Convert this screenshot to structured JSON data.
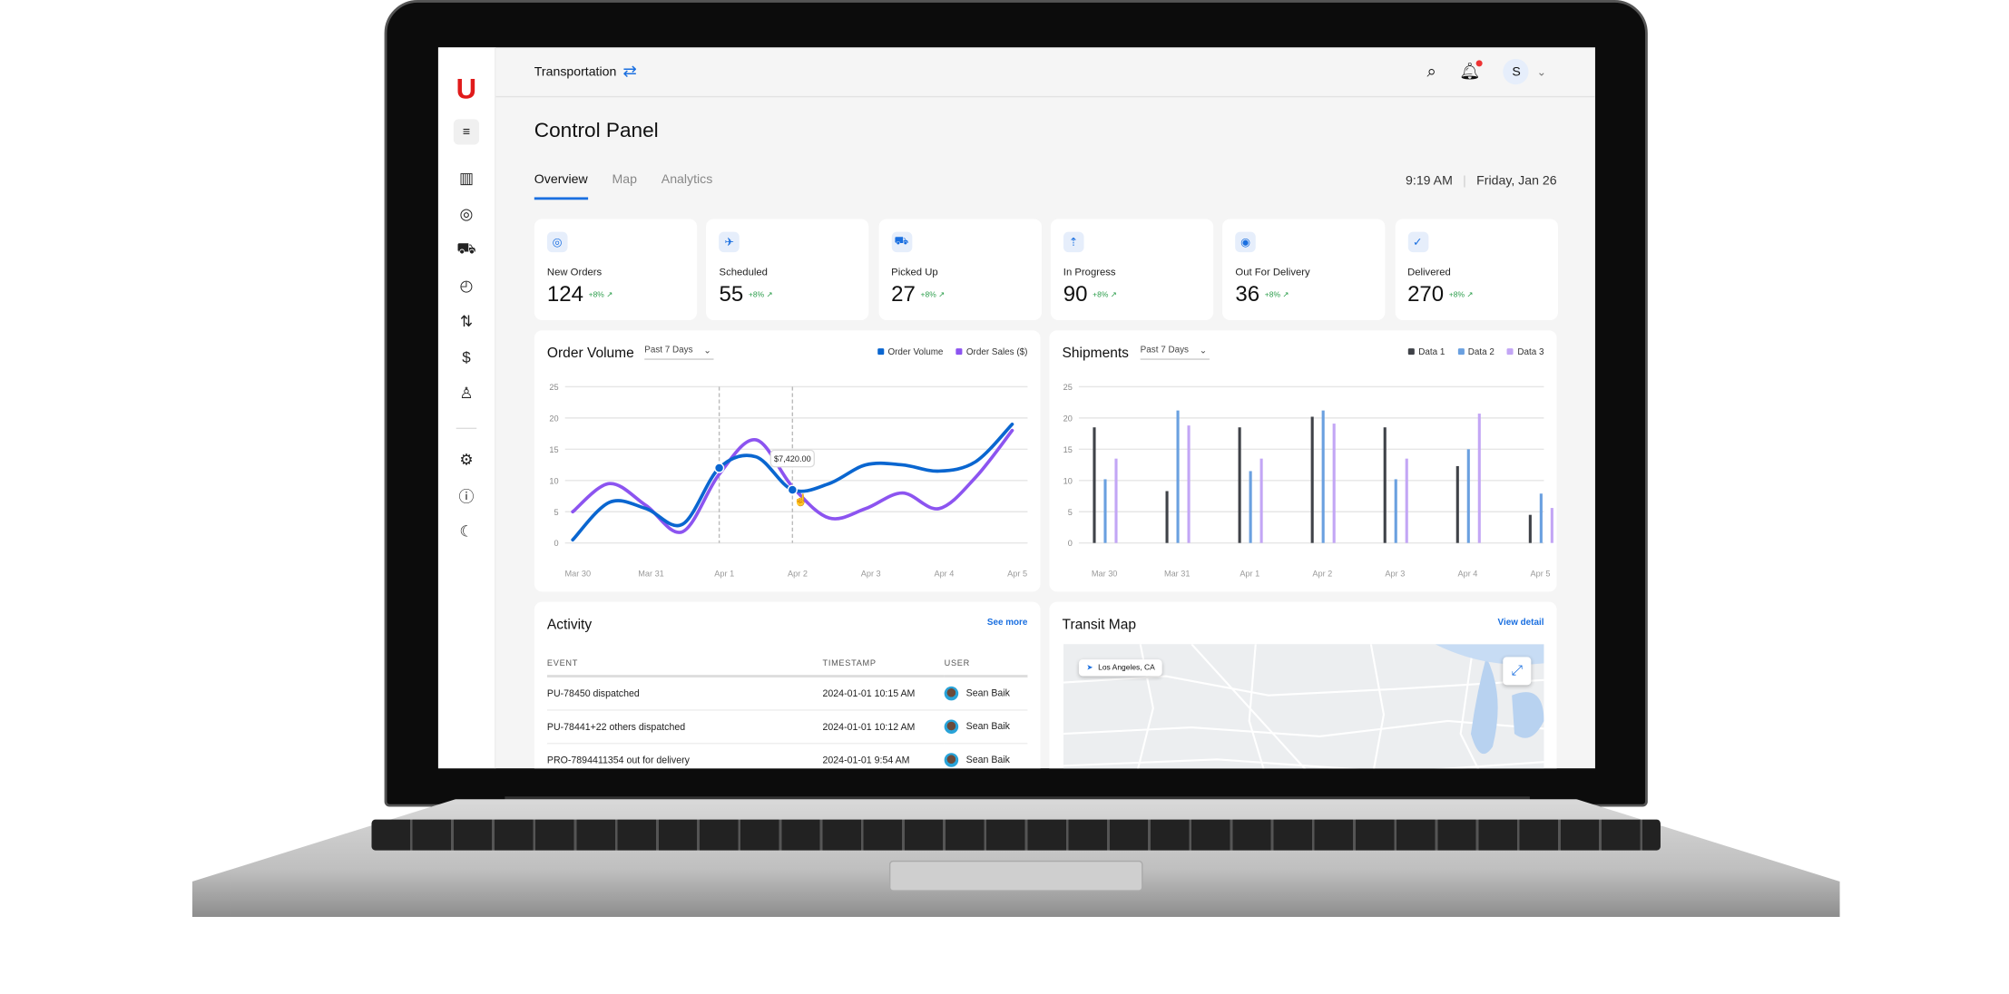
{
  "app": {
    "logo": "U",
    "workspace": "Transportation",
    "avatar_initial": "S"
  },
  "sidebar": {
    "icons": [
      "menu-collapse-icon",
      "map-icon",
      "target-icon",
      "truck-icon",
      "gauge-icon",
      "route-icon",
      "dollar-icon",
      "user-icon",
      "gear-icon",
      "help-icon",
      "moon-icon"
    ]
  },
  "page": {
    "title": "Control Panel",
    "tabs": [
      "Overview",
      "Map",
      "Analytics"
    ],
    "active_tab": "Overview",
    "time": "9:19 AM",
    "date": "Friday, Jan 26"
  },
  "stats": [
    {
      "label": "New Orders",
      "value": "124",
      "change": "+8%"
    },
    {
      "label": "Scheduled",
      "value": "55",
      "change": "+8%"
    },
    {
      "label": "Picked Up",
      "value": "27",
      "change": "+8%"
    },
    {
      "label": "In Progress",
      "value": "90",
      "change": "+8%"
    },
    {
      "label": "Out For Delivery",
      "value": "36",
      "change": "+8%"
    },
    {
      "label": "Delivered",
      "value": "270",
      "change": "+8%"
    }
  ],
  "colors": {
    "accent": "#1a6fe0",
    "logo": "#e01b1b",
    "positive": "#2a9d4a"
  },
  "chart_data": [
    {
      "type": "line",
      "title": "Order Volume",
      "range_select": "Past 7 Days",
      "x": [
        "Mar 30",
        "Mar 30 12:00",
        "Mar 31",
        "Mar 31 12:00",
        "Apr 1",
        "Apr 1 12:00",
        "Apr 2",
        "Apr 2 12:00",
        "Apr 3",
        "Apr 3 12:00",
        "Apr 4",
        "Apr 4 12:00",
        "Apr 5"
      ],
      "xticks": [
        "Mar 30",
        "Mar 31",
        "Apr 1",
        "Apr 2",
        "Apr 3",
        "Apr 4",
        "Apr 5"
      ],
      "yticks": [
        0,
        5,
        10,
        15,
        20,
        25
      ],
      "ylim": [
        0,
        25
      ],
      "grid": true,
      "legend": "top-right",
      "series": [
        {
          "name": "Order Volume",
          "color": "#0a66d0",
          "values": [
            0.5,
            6.5,
            5.5,
            3,
            12,
            13.8,
            8.5,
            9.5,
            12.5,
            12.5,
            11.5,
            13,
            19
          ]
        },
        {
          "name": "Order Sales ($)",
          "color": "#8c54f0",
          "values": [
            5,
            9.5,
            6,
            1.8,
            11,
            16.5,
            9,
            4,
            5.5,
            8,
            5.5,
            10.5,
            18
          ]
        }
      ],
      "tooltip": {
        "x": "Apr 2",
        "label": "$7,420.00"
      },
      "highlighted": [
        "Apr 1",
        "Apr 2"
      ]
    },
    {
      "type": "bar",
      "title": "Shipments",
      "range_select": "Past 7 Days",
      "categories": [
        "Mar 30",
        "Mar 31",
        "Apr 1",
        "Apr 2",
        "Apr 3",
        "Apr 4",
        "Apr 5"
      ],
      "yticks": [
        0,
        5,
        10,
        15,
        20,
        25
      ],
      "ylim": [
        0,
        25
      ],
      "grid": true,
      "legend": "top-right",
      "series": [
        {
          "name": "Data 1",
          "color": "#3f4248",
          "values": [
            18.5,
            8.3,
            18.5,
            20.2,
            18.5,
            12.3,
            4.5
          ]
        },
        {
          "name": "Data 2",
          "color": "#6aa0e0",
          "values": [
            10.2,
            21.2,
            11.5,
            21.2,
            10.2,
            15,
            7.9
          ]
        },
        {
          "name": "Data 3",
          "color": "#c3a6f5",
          "values": [
            13.5,
            18.8,
            13.5,
            19.1,
            13.5,
            20.7,
            5.6
          ]
        }
      ]
    }
  ],
  "activity": {
    "title": "Activity",
    "see_more": "See more",
    "columns": [
      "EVENT",
      "TIMESTAMP",
      "USER"
    ],
    "rows": [
      [
        "PU-78450 dispatched",
        "2024-01-01  10:15 AM",
        "Sean Baik"
      ],
      [
        "PU-78441+22 others dispatched",
        "2024-01-01  10:12 AM",
        "Sean Baik"
      ],
      [
        "PRO-7894411354 out for delivery",
        "2024-01-01  9:54 AM",
        "Sean Baik"
      ]
    ]
  },
  "transit_map": {
    "title": "Transit Map",
    "view_detail": "View detail",
    "location": "Los Angeles, CA"
  }
}
